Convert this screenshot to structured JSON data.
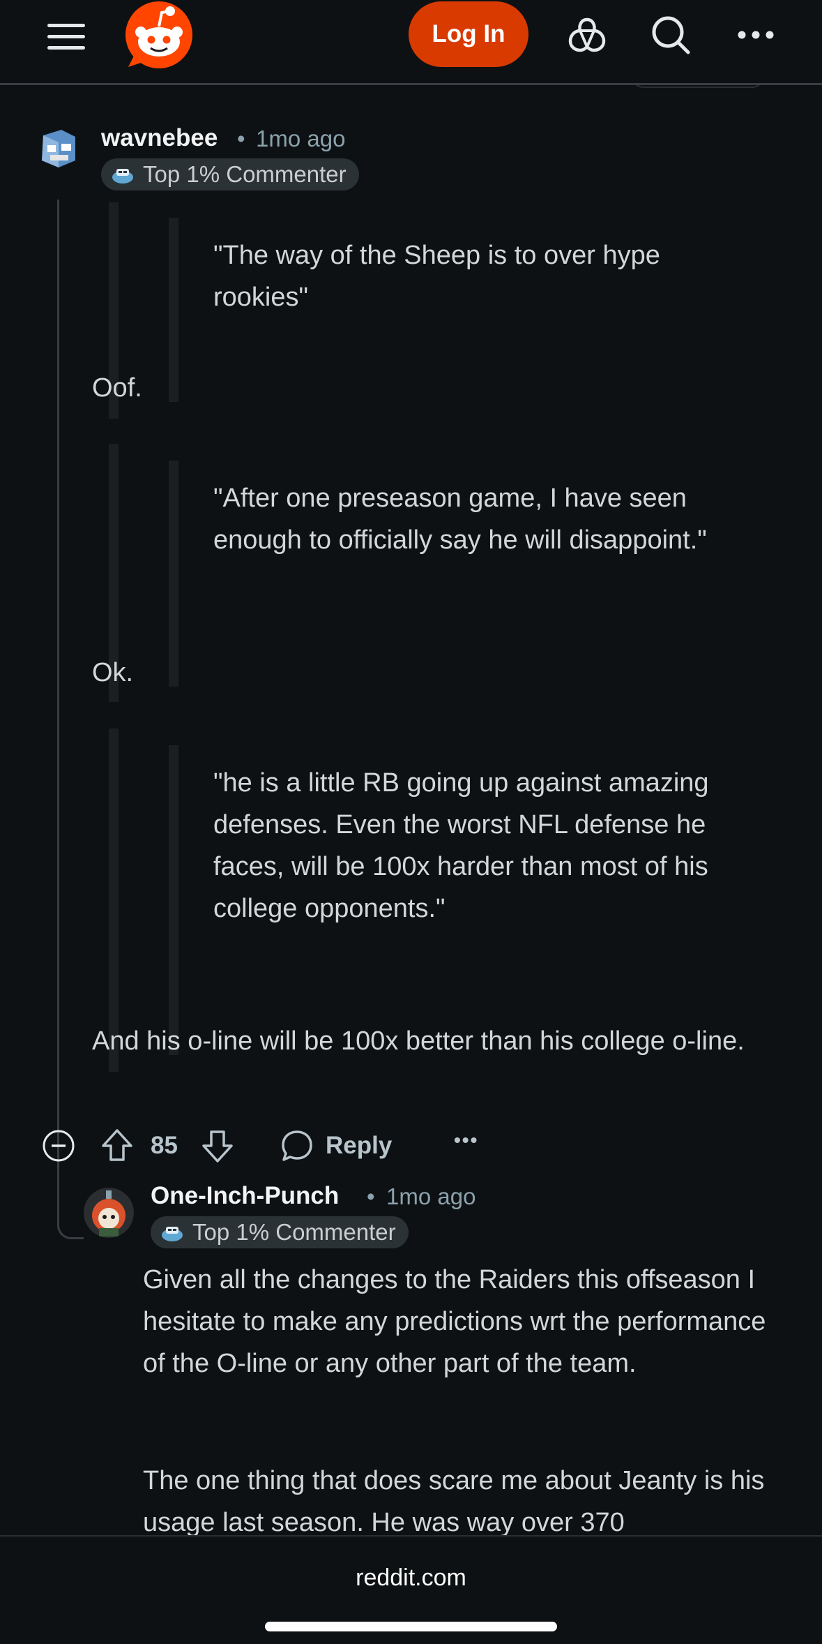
{
  "header": {
    "login_label": "Log In"
  },
  "colors": {
    "background": "#0e1113",
    "login_button": "#d93a00",
    "flair_bg": "#2a3236",
    "meta_text": "#8ba2ad"
  },
  "icons": [
    "menu-icon",
    "reddit-logo",
    "advertise-icon",
    "search-icon",
    "more-options-icon",
    "upvote-icon",
    "downvote-icon",
    "comment-icon",
    "collapse-icon"
  ],
  "comment1": {
    "username": "wavnebee",
    "separator": "•",
    "time": "1mo ago",
    "flair": "Top 1% Commenter",
    "quote1": "\"The way of the Sheep is to over hype rookies\"",
    "text1": "Oof.",
    "quote2": "\"After one preseason game, I have seen enough to officially say he will disappoint.\"",
    "text2": "Ok.",
    "quote3": "\"he is a little RB going up against amazing defenses. Even the worst NFL defense he faces, will be 100x harder than most of his college opponents.\"",
    "text3": "And his o-line will be 100x better than his college o-line.",
    "votes": "85",
    "reply_label": "Reply",
    "more_label": "•••"
  },
  "comment2": {
    "username": "One-Inch-Punch",
    "separator": "•",
    "time": "1mo ago",
    "flair": "Top 1% Commenter",
    "paragraph1": "Given all the changes to the Raiders this offseason I hesitate to make any predictions wrt the performance of the O-line or any other part of the team.",
    "paragraph2": "The one thing that does scare me about Jeanty is his usage last season. He was way over 370"
  },
  "footer": {
    "domain": "reddit.com"
  }
}
